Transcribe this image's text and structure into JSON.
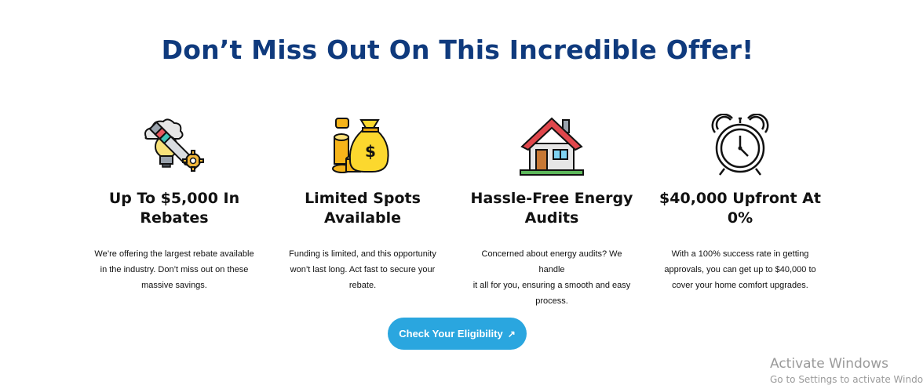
{
  "heading": "Don’t Miss Out On This Incredible Offer!",
  "features": [
    {
      "icon": "idea-bulb-pencil-icon",
      "title_line1": "Up To $5,000 In",
      "title_line2": "Rebates",
      "desc_line1": "We’re offering the largest rebate available",
      "desc_line2": "in the industry. Don’t miss out on these",
      "desc_line3": "massive savings."
    },
    {
      "icon": "money-bag-coins-icon",
      "title_line1": "Limited Spots",
      "title_line2": "Available",
      "desc_line1": "Funding is limited, and this opportunity",
      "desc_line2": "won’t last long. Act fast to secure your",
      "desc_line3": "rebate."
    },
    {
      "icon": "house-icon",
      "title_line1": "Hassle-Free Energy",
      "title_line2": "Audits",
      "desc_line1": "Concerned about energy audits? We handle",
      "desc_line2": "it all for you, ensuring a smooth and easy",
      "desc_line3": "process."
    },
    {
      "icon": "alarm-clock-icon",
      "title_line1": "$40,000 Upfront At",
      "title_line2": "0%",
      "desc_line1": "With a 100% success rate in getting",
      "desc_line2": "approvals, you can get up to $40,000 to",
      "desc_line3": "cover your home comfort upgrades."
    }
  ],
  "cta": {
    "label": "Check Your Eligibility",
    "icon": "arrow-up-right-icon"
  },
  "watermark": {
    "line1": "Activate Windows",
    "line2": "Go to Settings to activate Windows."
  },
  "colors": {
    "heading": "#0f3a7d",
    "cta_bg": "#2aa6df",
    "cta_text": "#ffffff"
  }
}
